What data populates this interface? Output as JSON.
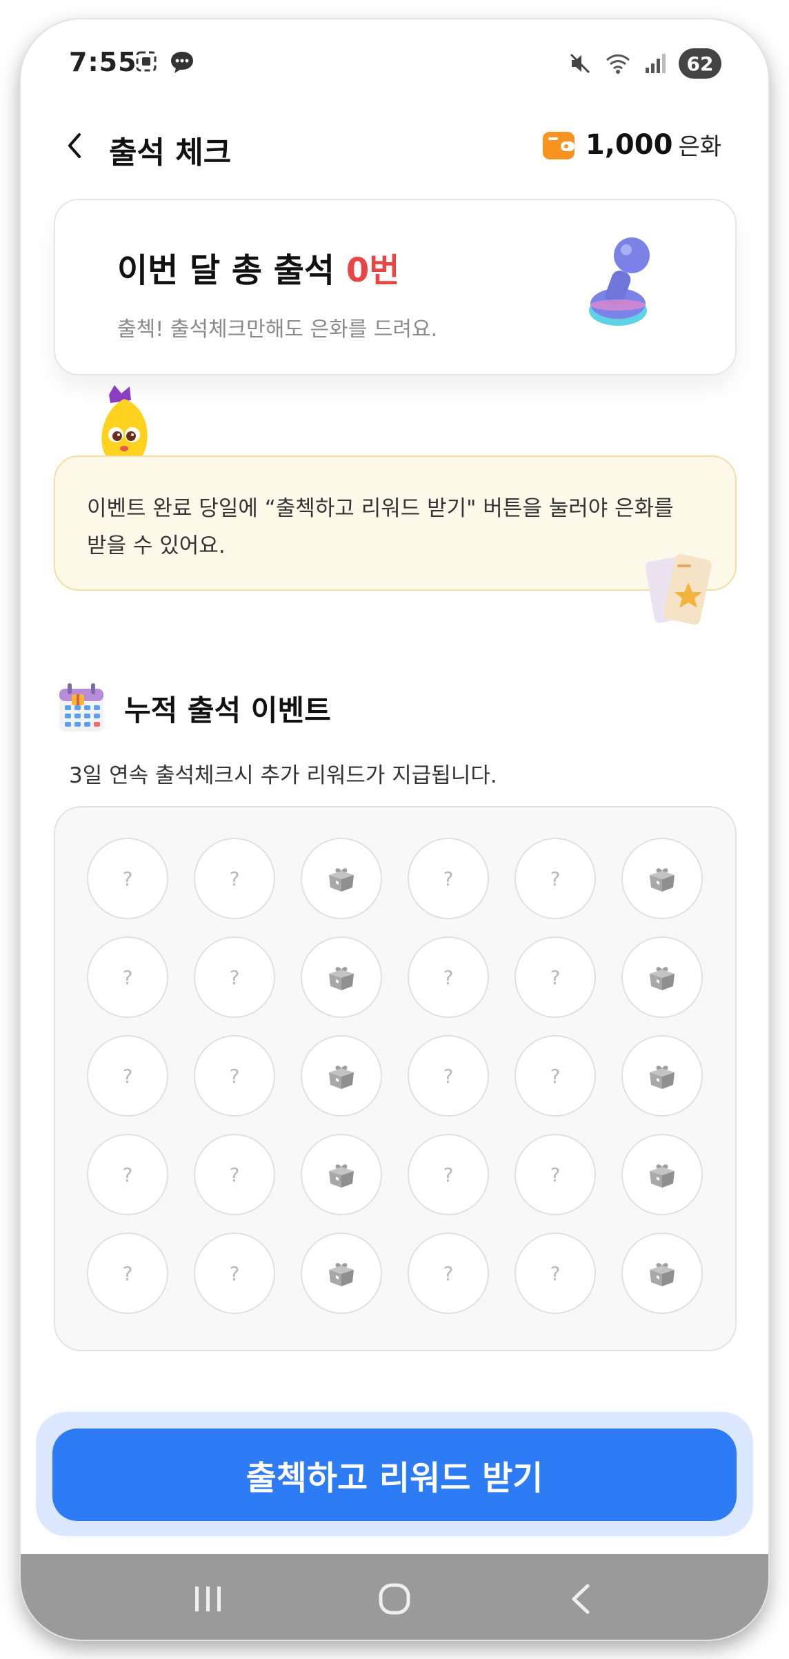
{
  "status_bar": {
    "time": "7:55",
    "battery": "62"
  },
  "header": {
    "title": "출석 체크",
    "currency_amount": "1,000",
    "currency_unit": "은화"
  },
  "summary": {
    "title_prefix": "이번 달 총 출석 ",
    "count": "0번",
    "subtitle": "출첵! 출석체크만해도 은화를 드려요."
  },
  "notice": {
    "text": "이벤트 완료 당일에 “출첵하고 리워드 받기\" 버튼을 눌러야 은화를 받을 수 있어요."
  },
  "event": {
    "title": "누적 출석 이벤트",
    "description": "3일 연속 출석체크시 추가 리워드가 지급됩니다.",
    "rows": [
      [
        "?",
        "?",
        "gift",
        "?",
        "?",
        "gift"
      ],
      [
        "?",
        "?",
        "gift",
        "?",
        "?",
        "gift"
      ],
      [
        "?",
        "?",
        "gift",
        "?",
        "?",
        "gift"
      ],
      [
        "?",
        "?",
        "gift",
        "?",
        "?",
        "gift"
      ],
      [
        "?",
        "?",
        "gift",
        "?",
        "?",
        "gift"
      ]
    ]
  },
  "cta": {
    "label": "출첵하고 리워드 받기"
  },
  "colors": {
    "accent": "#2e7bf6",
    "count_red": "#e84545",
    "notice_bg": "#fdf8e7",
    "coin_orange": "#f7931e"
  }
}
